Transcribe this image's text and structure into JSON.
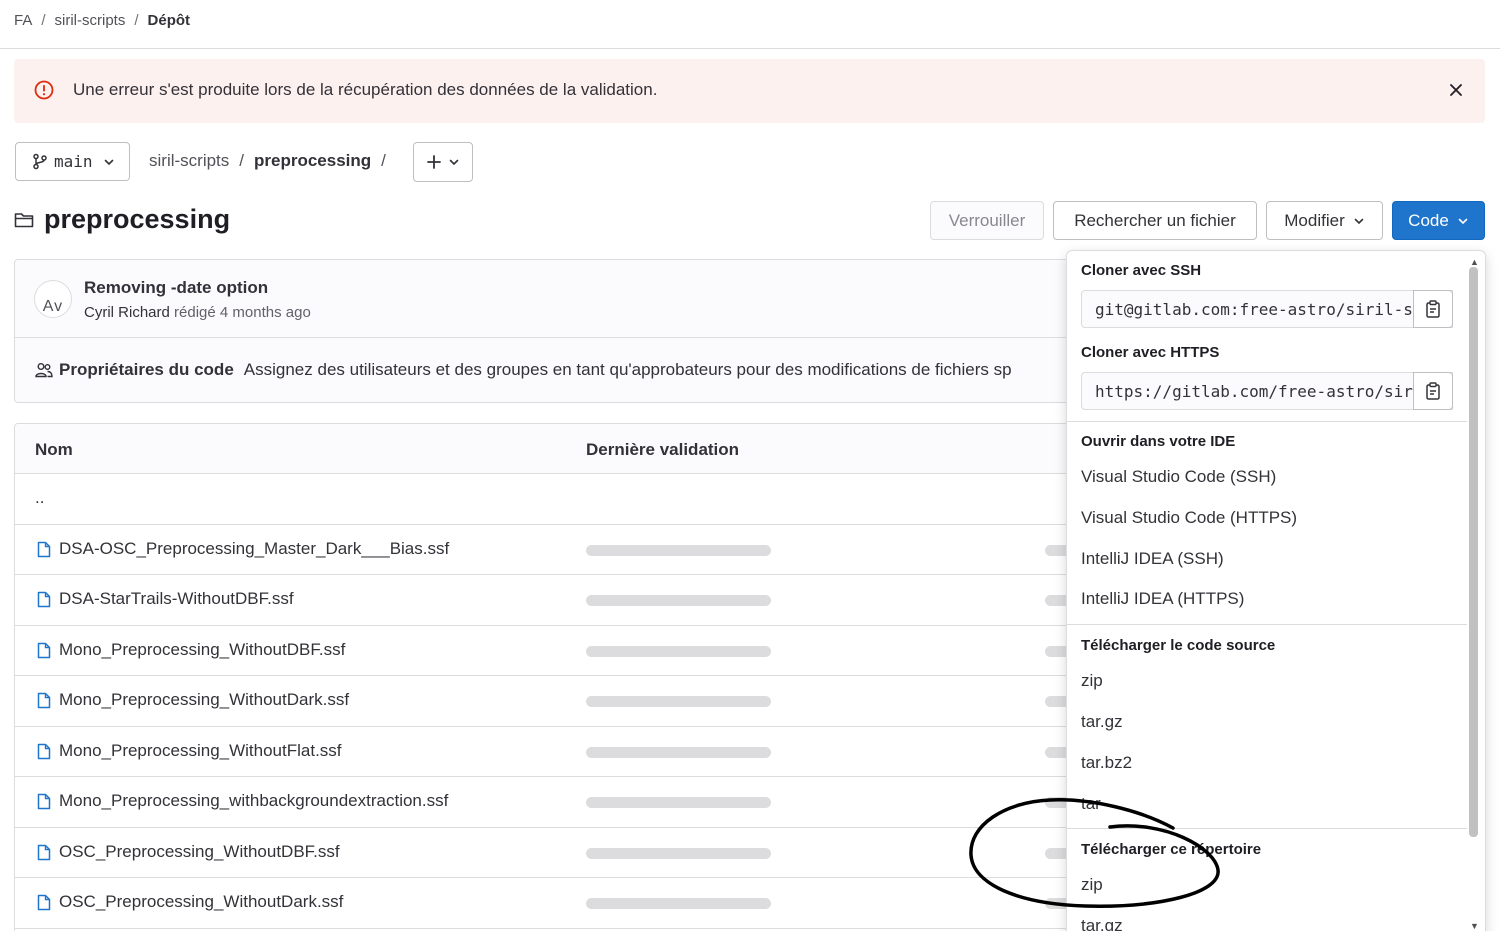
{
  "breadcrumb": {
    "items": [
      "FA",
      "siril-scripts",
      "Dépôt"
    ],
    "separator": "/"
  },
  "alert": {
    "message": "Une erreur s'est produite lors de la récupération des données de la validation."
  },
  "repo": {
    "branch": "main",
    "path_root": "siril-scripts",
    "path_folder": "preprocessing",
    "path_separator": "/"
  },
  "page": {
    "title": "preprocessing"
  },
  "toolbar": {
    "lock": "Verrouiller",
    "find_file": "Rechercher un fichier",
    "edit": "Modifier",
    "code": "Code"
  },
  "commit": {
    "avatar_alt": "Av",
    "title": "Removing -date option",
    "author": "Cyril Richard",
    "verb": "rédigé",
    "time": "4 months ago"
  },
  "code_owners": {
    "label": "Propriétaires du code",
    "text": "Assignez des utilisateurs et des groupes en tant qu'approbateurs pour des modifications de fichiers sp"
  },
  "table": {
    "col_name": "Nom",
    "col_last_commit": "Dernière validation",
    "parent": "..",
    "files": [
      "DSA-OSC_Preprocessing_Master_Dark___Bias.ssf",
      "DSA-StarTrails-WithoutDBF.ssf",
      "Mono_Preprocessing_WithoutDBF.ssf",
      "Mono_Preprocessing_WithoutDark.ssf",
      "Mono_Preprocessing_WithoutFlat.ssf",
      "Mono_Preprocessing_withbackgroundextraction.ssf",
      "OSC_Preprocessing_WithoutDBF.ssf",
      "OSC_Preprocessing_WithoutDark.ssf"
    ]
  },
  "dropdown": {
    "ssh_label": "Cloner avec SSH",
    "ssh_value": "git@gitlab.com:free-astro/siril-scripts.git",
    "https_label": "Cloner avec HTTPS",
    "https_value": "https://gitlab.com/free-astro/siril-scripts.git",
    "ide_label": "Ouvrir dans votre IDE",
    "ide_items": [
      "Visual Studio Code (SSH)",
      "Visual Studio Code (HTTPS)",
      "IntelliJ IDEA (SSH)",
      "IntelliJ IDEA (HTTPS)"
    ],
    "source_label": "Télécharger le code source",
    "source_items": [
      "zip",
      "tar.gz",
      "tar.bz2",
      "tar"
    ],
    "dir_label": "Télécharger ce répertoire",
    "dir_items": [
      "zip",
      "tar.gz"
    ]
  },
  "colors": {
    "primary": "#1f75cb",
    "alert_bg": "#fcf1ef",
    "alert_icon": "#dd2b0e",
    "file_icon": "#1f75cb",
    "annotation": "#000000"
  }
}
